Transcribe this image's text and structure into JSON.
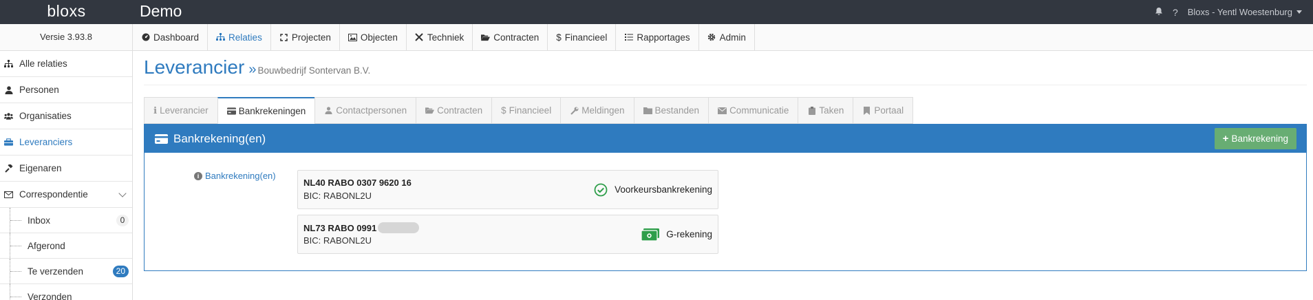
{
  "header": {
    "brand": "bloxs",
    "app_title": "Demo",
    "user": "Bloxs - Yentl Woestenburg"
  },
  "version": "Versie 3.93.8",
  "mainnav": [
    {
      "label": "Dashboard",
      "icon": "dashboard-icon"
    },
    {
      "label": "Relaties",
      "icon": "sitemap-icon",
      "active": true
    },
    {
      "label": "Projecten",
      "icon": "expand-icon"
    },
    {
      "label": "Objecten",
      "icon": "image-icon"
    },
    {
      "label": "Techniek",
      "icon": "tools-icon"
    },
    {
      "label": "Contracten",
      "icon": "folder-open-icon"
    },
    {
      "label": "Financieel",
      "icon": "dollar-icon"
    },
    {
      "label": "Rapportages",
      "icon": "list-icon"
    },
    {
      "label": "Admin",
      "icon": "gear-icon"
    }
  ],
  "sidebar": {
    "items": [
      {
        "label": "Alle relaties",
        "icon": "sitemap-icon"
      },
      {
        "label": "Personen",
        "icon": "user-icon"
      },
      {
        "label": "Organisaties",
        "icon": "users-icon"
      },
      {
        "label": "Leveranciers",
        "icon": "truck-icon",
        "active": true
      },
      {
        "label": "Eigenaren",
        "icon": "gavel-icon"
      },
      {
        "label": "Correspondentie",
        "icon": "envelope-icon"
      }
    ],
    "subitems": [
      {
        "label": "Inbox",
        "count": "0"
      },
      {
        "label": "Afgerond",
        "count": ""
      },
      {
        "label": "Te verzenden",
        "count": "20"
      },
      {
        "label": "Verzonden",
        "count": ""
      }
    ]
  },
  "page": {
    "title": "Leverancier",
    "subtitle": "Bouwbedrijf Sontervan B.V."
  },
  "tabs": [
    {
      "label": "Leverancier",
      "icon": "info-icon"
    },
    {
      "label": "Bankrekeningen",
      "icon": "credit-card-icon",
      "active": true
    },
    {
      "label": "Contactpersonen",
      "icon": "user-icon"
    },
    {
      "label": "Contracten",
      "icon": "folder-open-icon"
    },
    {
      "label": "Financieel",
      "icon": "dollar-icon"
    },
    {
      "label": "Meldingen",
      "icon": "wrench-icon"
    },
    {
      "label": "Bestanden",
      "icon": "folder-icon"
    },
    {
      "label": "Communicatie",
      "icon": "envelope-icon"
    },
    {
      "label": "Taken",
      "icon": "clipboard-icon"
    },
    {
      "label": "Portaal",
      "icon": "bookmark-icon"
    }
  ],
  "panel": {
    "title": "Bankrekening(en)",
    "add_button": "Bankrekening",
    "field_label": "Bankrekening(en)"
  },
  "accounts": [
    {
      "iban": "NL40 RABO 0307 9620 16",
      "bic": "BIC: RABONL2U",
      "tag": "Voorkeursbankrekening",
      "tag_icon": "check-circle-icon"
    },
    {
      "iban": "NL73 RABO 0991",
      "bic": "BIC: RABONL2U",
      "tag": "G-rekening",
      "tag_icon": "money-icon"
    }
  ],
  "colors": {
    "topbar": "#323740",
    "accent": "#2f7bbf",
    "success": "#68ad73",
    "check": "#2e9e4a"
  }
}
